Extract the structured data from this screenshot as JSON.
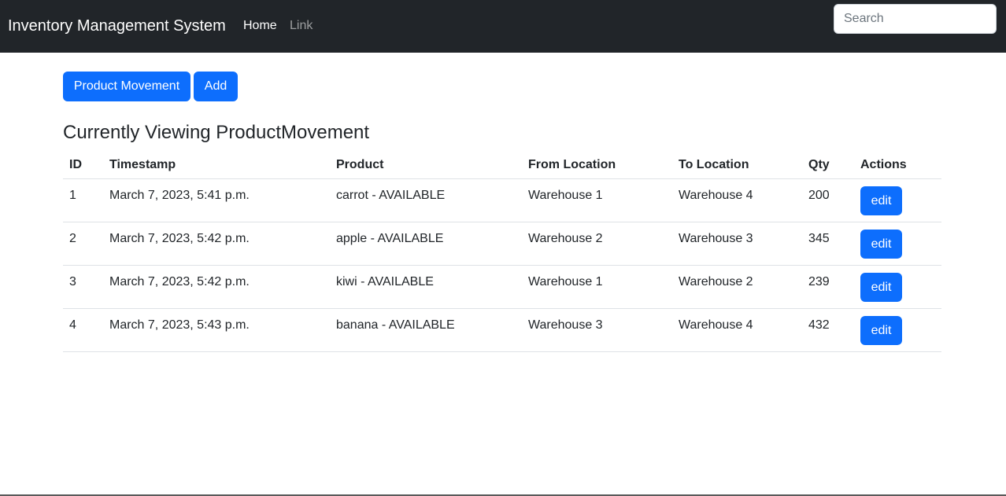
{
  "navbar": {
    "brand": "Inventory Management System",
    "links": [
      "Home",
      "Link"
    ],
    "search_placeholder": "Search"
  },
  "toolbar": {
    "product_movement_label": "Product Movement",
    "add_label": "Add"
  },
  "page": {
    "heading": "Currently Viewing ProductMovement"
  },
  "table": {
    "columns": [
      "ID",
      "Timestamp",
      "Product",
      "From Location",
      "To Location",
      "Qty",
      "Actions"
    ],
    "rows": [
      [
        "1",
        "March 7, 2023, 5:41 p.m.",
        "carrot - AVAILABLE",
        "Warehouse 1",
        "Warehouse 4",
        "200"
      ],
      [
        "2",
        "March 7, 2023, 5:42 p.m.",
        "apple - AVAILABLE",
        "Warehouse 2",
        "Warehouse 3",
        "345"
      ],
      [
        "3",
        "March 7, 2023, 5:42 p.m.",
        "kiwi - AVAILABLE",
        "Warehouse 1",
        "Warehouse 2",
        "239"
      ],
      [
        "4",
        "March 7, 2023, 5:43 p.m.",
        "banana - AVAILABLE",
        "Warehouse 3",
        "Warehouse 4",
        "432"
      ]
    ],
    "edit_label": "edit"
  },
  "colors": {
    "navbar_bg": "#212529",
    "primary": "#0d6efd"
  }
}
